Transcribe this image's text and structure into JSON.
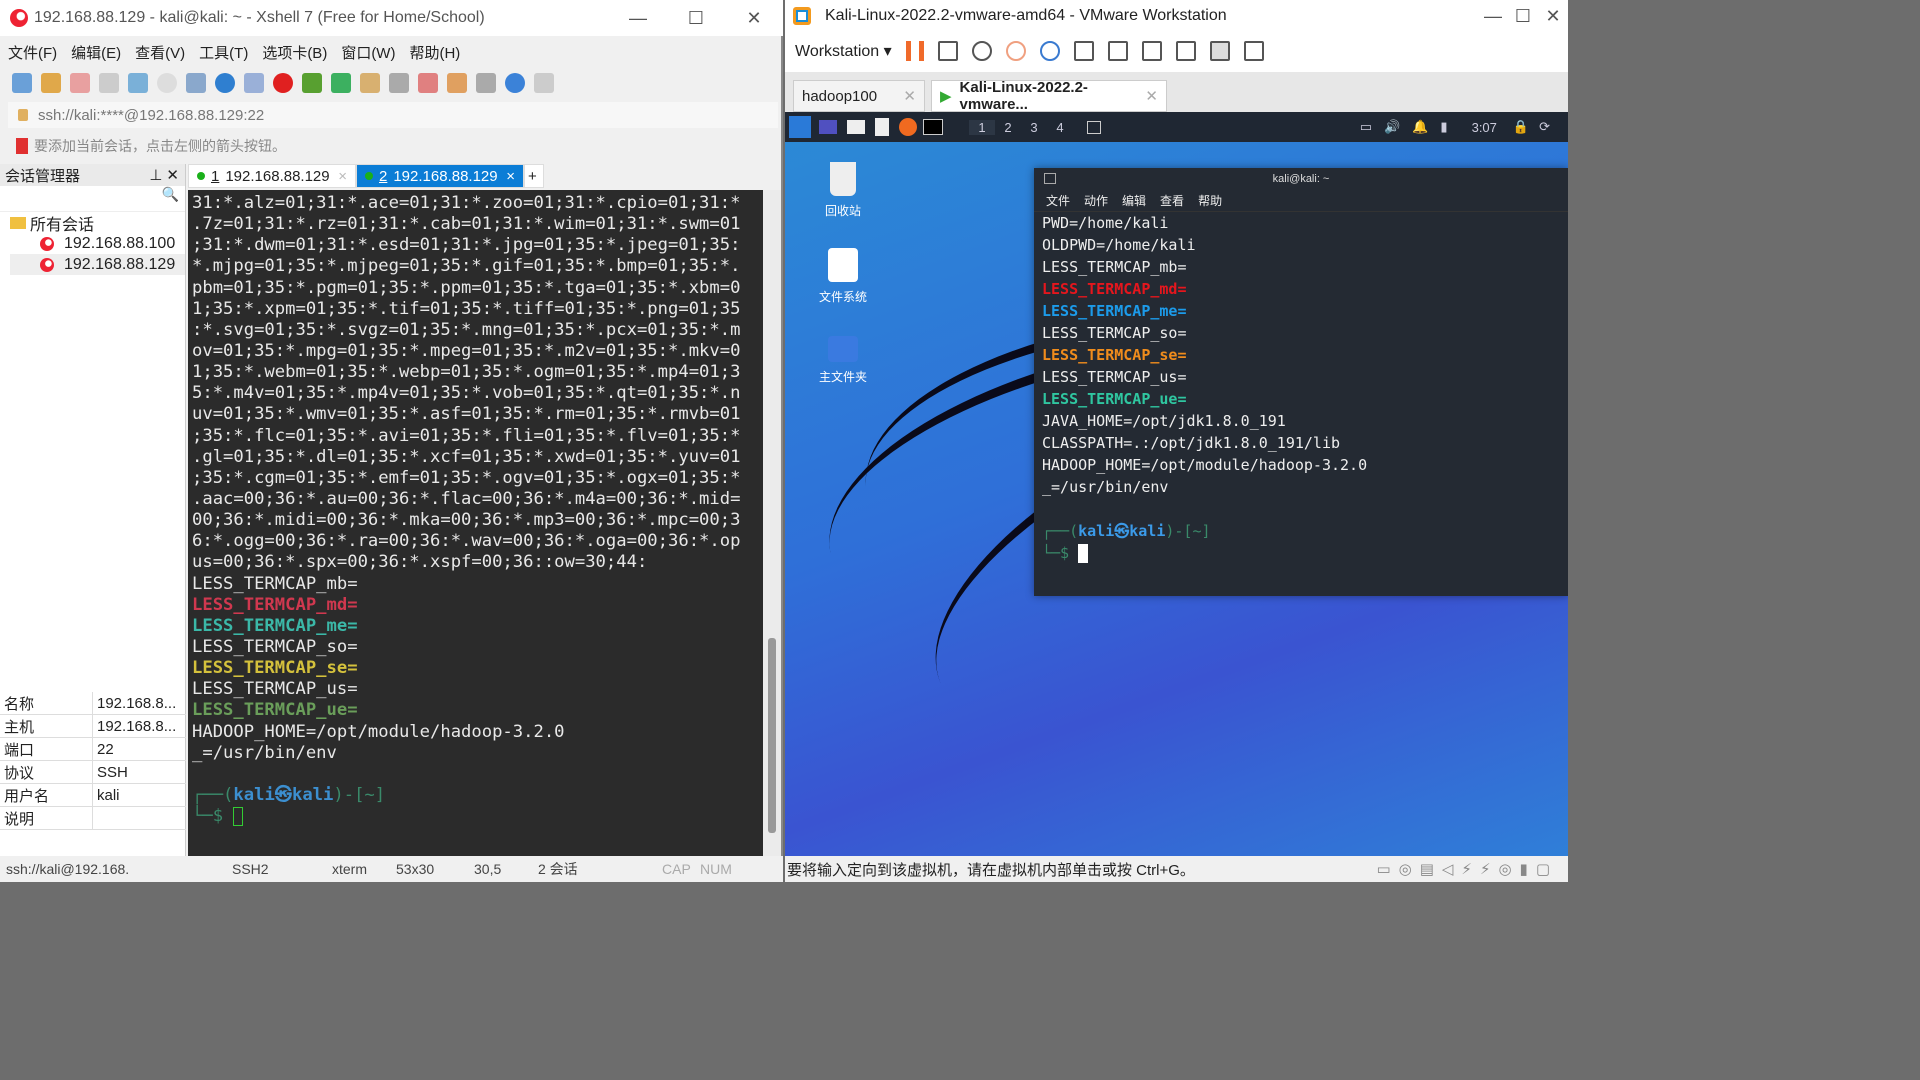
{
  "xshell": {
    "title": "192.168.88.129 - kali@kali: ~ - Xshell 7 (Free for Home/School)",
    "window_buttons": [
      "—",
      "☐",
      "✕"
    ],
    "menu": [
      "文件(F)",
      "编辑(E)",
      "查看(V)",
      "工具(T)",
      "选项卡(B)",
      "窗口(W)",
      "帮助(H)"
    ],
    "address": "ssh://kali:****@192.168.88.129:22",
    "hint": "要添加当前会话，点击左侧的箭头按钮。",
    "session_manager": {
      "title": "会话管理器",
      "root": "所有会话",
      "sessions": [
        "192.168.88.100",
        "192.168.88.129"
      ]
    },
    "properties": [
      {
        "k": "名称",
        "v": "192.168.8..."
      },
      {
        "k": "主机",
        "v": "192.168.8..."
      },
      {
        "k": "端口",
        "v": "22"
      },
      {
        "k": "协议",
        "v": "SSH"
      },
      {
        "k": "用户名",
        "v": "kali"
      },
      {
        "k": "说明",
        "v": ""
      }
    ],
    "tabs": [
      {
        "num": "1",
        "label": "192.168.88.129"
      },
      {
        "num": "2",
        "label": "192.168.88.129"
      }
    ],
    "terminal_lines": [
      {
        "t": "31:*.alz=01;31:*.ace=01;31:*.zoo=01;31:*.cpio=01;31:*"
      },
      {
        "t": ".7z=01;31:*.rz=01;31:*.cab=01;31:*.wim=01;31:*.swm=01"
      },
      {
        "t": ";31:*.dwm=01;31:*.esd=01;31:*.jpg=01;35:*.jpeg=01;35:"
      },
      {
        "t": "*.mjpg=01;35:*.mjpeg=01;35:*.gif=01;35:*.bmp=01;35:*."
      },
      {
        "t": "pbm=01;35:*.pgm=01;35:*.ppm=01;35:*.tga=01;35:*.xbm=0"
      },
      {
        "t": "1;35:*.xpm=01;35:*.tif=01;35:*.tiff=01;35:*.png=01;35"
      },
      {
        "t": ":*.svg=01;35:*.svgz=01;35:*.mng=01;35:*.pcx=01;35:*.m"
      },
      {
        "t": "ov=01;35:*.mpg=01;35:*.mpeg=01;35:*.m2v=01;35:*.mkv=0"
      },
      {
        "t": "1;35:*.webm=01;35:*.webp=01;35:*.ogm=01;35:*.mp4=01;3"
      },
      {
        "t": "5:*.m4v=01;35:*.mp4v=01;35:*.vob=01;35:*.qt=01;35:*.n"
      },
      {
        "t": "uv=01;35:*.wmv=01;35:*.asf=01;35:*.rm=01;35:*.rmvb=01"
      },
      {
        "t": ";35:*.flc=01;35:*.avi=01;35:*.fli=01;35:*.flv=01;35:*"
      },
      {
        "t": ".gl=01;35:*.dl=01;35:*.xcf=01;35:*.xwd=01;35:*.yuv=01"
      },
      {
        "t": ";35:*.cgm=01;35:*.emf=01;35:*.ogv=01;35:*.ogx=01;35:*"
      },
      {
        "t": ".aac=00;36:*.au=00;36:*.flac=00;36:*.m4a=00;36:*.mid="
      },
      {
        "t": "00;36:*.midi=00;36:*.mka=00;36:*.mp3=00;36:*.mpc=00;3"
      },
      {
        "t": "6:*.ogg=00;36:*.ra=00;36:*.wav=00;36:*.oga=00;36:*.op"
      },
      {
        "t": "us=00;36:*.spx=00;36:*.xspf=00;36::ow=30;44:"
      },
      {
        "t": "LESS_TERMCAP_mb="
      },
      {
        "t": "LESS_TERMCAP_md=",
        "c": "#d0384f"
      },
      {
        "t": "LESS_TERMCAP_me=",
        "c": "#3bb8a8"
      },
      {
        "t": "LESS_TERMCAP_so="
      },
      {
        "t": "LESS_TERMCAP_se=",
        "c": "#d4c13c"
      },
      {
        "t": "LESS_TERMCAP_us="
      },
      {
        "t": "LESS_TERMCAP_ue=",
        "c": "#6a9e5a"
      },
      {
        "t": "HADOOP_HOME=/opt/module/hadoop-3.2.0"
      },
      {
        "t": "_=/usr/bin/env"
      },
      {
        "t": ""
      }
    ],
    "prompt": {
      "open": "┌──(",
      "user": "kali㉿kali",
      "close": ")-[~]",
      "second": "└─$ "
    },
    "status": [
      "ssh://kali@192.168.",
      "SSH2",
      "xterm",
      "53x30",
      "30,5",
      "2 会话",
      "CAP",
      "NUM"
    ]
  },
  "vmware": {
    "title": "Kali-Linux-2022.2-vmware-amd64 - VMware Workstation",
    "window_buttons": [
      "—",
      "☐",
      "✕"
    ],
    "menu_label": "Workstation",
    "tabs": [
      "hadoop100",
      "Kali-Linux-2022.2-vmware..."
    ],
    "workspaces": [
      "1",
      "2",
      "3",
      "4"
    ],
    "clock": "3:07",
    "desktop_icons": [
      "回收站",
      "文件系统",
      "主文件夹"
    ],
    "kali_terminal": {
      "title": "kali@kali: ~",
      "menu": [
        "文件",
        "动作",
        "编辑",
        "查看",
        "帮助"
      ],
      "lines": [
        {
          "t": "PWD=/home/kali"
        },
        {
          "t": "OLDPWD=/home/kali"
        },
        {
          "t": "LESS_TERMCAP_mb="
        },
        {
          "t": "LESS_TERMCAP_md=",
          "c": "#e5161d"
        },
        {
          "t": "LESS_TERMCAP_me=",
          "c": "#1c9bea"
        },
        {
          "t": "LESS_TERMCAP_so="
        },
        {
          "t": "LESS_TERMCAP_se=",
          "c": "#f08c1c"
        },
        {
          "t": "LESS_TERMCAP_us="
        },
        {
          "t": "LESS_TERMCAP_ue=",
          "c": "#2fc6a0"
        },
        {
          "t": "JAVA_HOME=/opt/jdk1.8.0_191"
        },
        {
          "t": "CLASSPATH=.:/opt/jdk1.8.0_191/lib"
        },
        {
          "t": "HADOOP_HOME=/opt/module/hadoop-3.2.0"
        },
        {
          "t": "_=/usr/bin/env"
        },
        {
          "t": ""
        }
      ],
      "prompt": {
        "open": "┌──(",
        "user": "kali㉿kali",
        "close": ")-[~]",
        "second": "└─$ "
      }
    },
    "status": "要将输入定向到该虚拟机，请在虚拟机内部单击或按 Ctrl+G。"
  }
}
